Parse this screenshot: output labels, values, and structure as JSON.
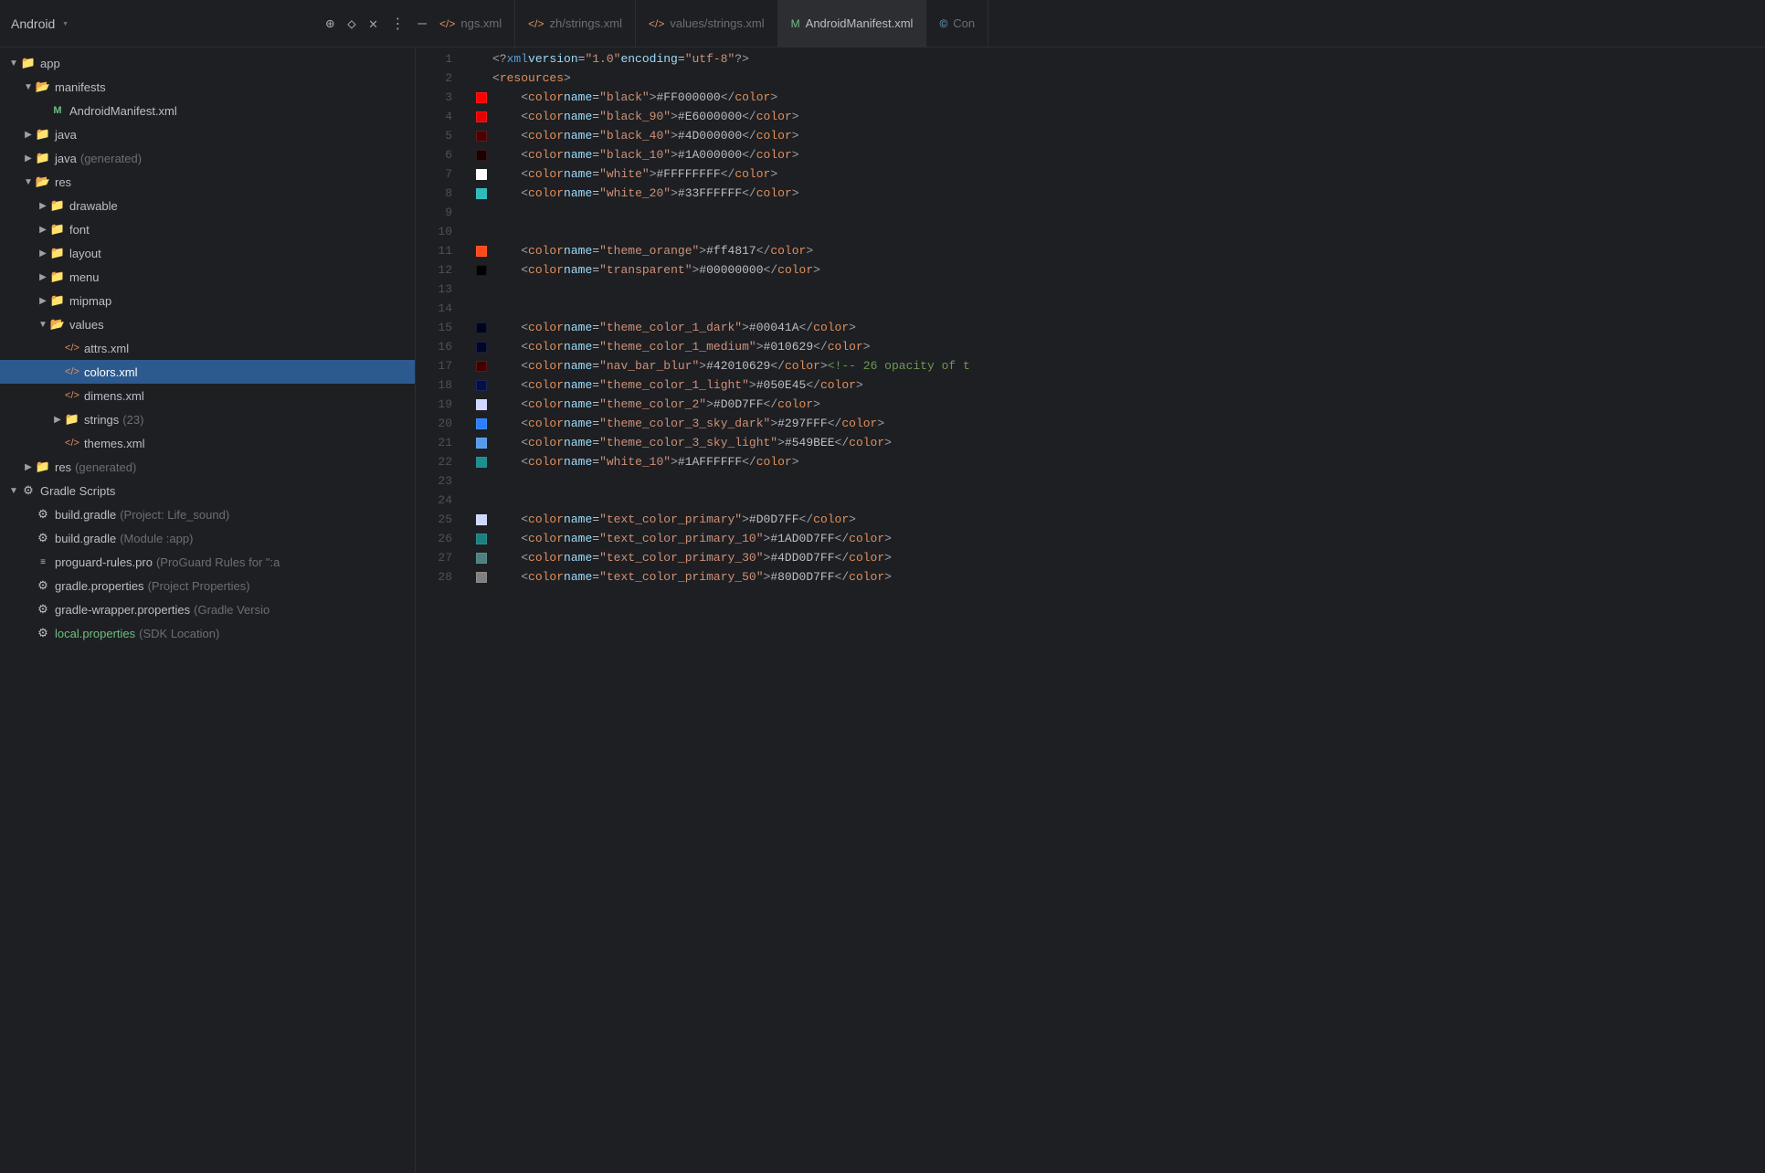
{
  "titleBar": {
    "appName": "Android",
    "chevron": "▾",
    "icons": [
      "+",
      "◇",
      "×",
      "⋮",
      "—"
    ]
  },
  "tabs": [
    {
      "id": "strings-xml",
      "icon": "</>",
      "label": "ngs.xml",
      "type": "xml"
    },
    {
      "id": "zh-strings",
      "icon": "</>",
      "label": "zh/strings.xml",
      "type": "xml"
    },
    {
      "id": "values-strings",
      "icon": "</>",
      "label": "values/strings.xml",
      "type": "xml"
    },
    {
      "id": "android-manifest",
      "icon": "M",
      "label": "AndroidManifest.xml",
      "type": "manifest"
    },
    {
      "id": "conf",
      "icon": "©",
      "label": "Con",
      "type": "conf"
    }
  ],
  "sidebar": {
    "items": [
      {
        "id": "app",
        "indent": 0,
        "arrow": "down",
        "icon": "folder",
        "label": "app",
        "labelMuted": ""
      },
      {
        "id": "manifests",
        "indent": 1,
        "arrow": "down",
        "icon": "folder-open",
        "label": "manifests",
        "labelMuted": ""
      },
      {
        "id": "android-manifest-file",
        "indent": 2,
        "arrow": "none",
        "icon": "manifest",
        "label": "AndroidManifest.xml",
        "labelMuted": ""
      },
      {
        "id": "java",
        "indent": 1,
        "arrow": "right",
        "icon": "folder",
        "label": "java",
        "labelMuted": ""
      },
      {
        "id": "java-generated",
        "indent": 1,
        "arrow": "right",
        "icon": "folder",
        "label": "java",
        "labelMuted": "(generated)"
      },
      {
        "id": "res",
        "indent": 1,
        "arrow": "down",
        "icon": "folder-open",
        "label": "res",
        "labelMuted": ""
      },
      {
        "id": "drawable",
        "indent": 2,
        "arrow": "right",
        "icon": "folder",
        "label": "drawable",
        "labelMuted": ""
      },
      {
        "id": "font",
        "indent": 2,
        "arrow": "right",
        "icon": "folder",
        "label": "font",
        "labelMuted": ""
      },
      {
        "id": "layout",
        "indent": 2,
        "arrow": "right",
        "icon": "folder",
        "label": "layout",
        "labelMuted": ""
      },
      {
        "id": "menu",
        "indent": 2,
        "arrow": "right",
        "icon": "folder",
        "label": "menu",
        "labelMuted": ""
      },
      {
        "id": "mipmap",
        "indent": 2,
        "arrow": "right",
        "icon": "folder",
        "label": "mipmap",
        "labelMuted": ""
      },
      {
        "id": "values",
        "indent": 2,
        "arrow": "down",
        "icon": "folder-open",
        "label": "values",
        "labelMuted": ""
      },
      {
        "id": "attrs-xml",
        "indent": 3,
        "arrow": "none",
        "icon": "xml",
        "label": "attrs.xml",
        "labelMuted": ""
      },
      {
        "id": "colors-xml",
        "indent": 3,
        "arrow": "none",
        "icon": "xml",
        "label": "colors.xml",
        "labelMuted": "",
        "selected": true
      },
      {
        "id": "dimens-xml",
        "indent": 3,
        "arrow": "none",
        "icon": "xml",
        "label": "dimens.xml",
        "labelMuted": ""
      },
      {
        "id": "strings",
        "indent": 3,
        "arrow": "right",
        "icon": "folder",
        "label": "strings",
        "labelMuted": "",
        "badge": "(23)"
      },
      {
        "id": "themes-xml",
        "indent": 3,
        "arrow": "none",
        "icon": "xml",
        "label": "themes.xml",
        "labelMuted": ""
      },
      {
        "id": "res-generated",
        "indent": 1,
        "arrow": "right",
        "icon": "folder",
        "label": "res",
        "labelMuted": "(generated)"
      },
      {
        "id": "gradle-scripts",
        "indent": 0,
        "arrow": "down",
        "icon": "gradle",
        "label": "Gradle Scripts",
        "labelMuted": ""
      },
      {
        "id": "build-gradle-project",
        "indent": 1,
        "arrow": "none",
        "icon": "gradle-file",
        "label": "build.gradle",
        "labelMuted": "(Project: Life_sound)"
      },
      {
        "id": "build-gradle-module",
        "indent": 1,
        "arrow": "none",
        "icon": "gradle-file",
        "label": "build.gradle",
        "labelMuted": "(Module :app)"
      },
      {
        "id": "proguard-rules",
        "indent": 1,
        "arrow": "none",
        "icon": "proguard",
        "label": "proguard-rules.pro",
        "labelMuted": "(ProGuard Rules for \":a"
      },
      {
        "id": "gradle-properties",
        "indent": 1,
        "arrow": "none",
        "icon": "properties",
        "label": "gradle.properties",
        "labelMuted": "(Project Properties)"
      },
      {
        "id": "gradle-wrapper",
        "indent": 1,
        "arrow": "none",
        "icon": "properties",
        "label": "gradle-wrapper.properties",
        "labelMuted": "(Gradle Versio"
      },
      {
        "id": "local-properties",
        "indent": 1,
        "arrow": "none",
        "icon": "properties",
        "label": "local.properties",
        "labelMuted": "(SDK Location)",
        "green": true
      }
    ]
  },
  "editor": {
    "lines": [
      {
        "num": 1,
        "swatch": null,
        "code": "<?xml version=\"1.0\" encoding=\"utf-8\"?>"
      },
      {
        "num": 2,
        "swatch": null,
        "code": "<resources>"
      },
      {
        "num": 3,
        "swatch": "#FF0000",
        "code": "    <color name=\"black\">#FF000000</color>"
      },
      {
        "num": 4,
        "swatch": "#E60000",
        "code": "    <color name=\"black_90\">#E6000000</color>"
      },
      {
        "num": 5,
        "swatch": "#4D0000",
        "code": "    <color name=\"black_40\">#4D000000</color>"
      },
      {
        "num": 6,
        "swatch": "#1A0000",
        "code": "    <color name=\"black_10\">#1A000000</color>"
      },
      {
        "num": 7,
        "swatch": "#FFFFFF",
        "code": "    <color name=\"white\">#FFFFFFFF</color>"
      },
      {
        "num": 8,
        "swatch": "#33FFFF",
        "code": "    <color name=\"white_20\">#33FFFFFF</color>"
      },
      {
        "num": 9,
        "swatch": null,
        "code": ""
      },
      {
        "num": 10,
        "swatch": null,
        "code": ""
      },
      {
        "num": 11,
        "swatch": "#ff4817",
        "code": "    <color name=\"theme_orange\">#ff4817</color>"
      },
      {
        "num": 12,
        "swatch": "#000000",
        "code": "    <color name=\"transparent\">#00000000</color>"
      },
      {
        "num": 13,
        "swatch": null,
        "code": ""
      },
      {
        "num": 14,
        "swatch": null,
        "code": ""
      },
      {
        "num": 15,
        "swatch": "#00041A",
        "code": "    <color name=\"theme_color_1_dark\">#00041A</color>"
      },
      {
        "num": 16,
        "swatch": "#010629",
        "code": "    <color name=\"theme_color_1_medium\">#010629</color>"
      },
      {
        "num": 17,
        "swatch": "#420000",
        "code": "    <color name=\"nav_bar_blur\">#42010629</color><!--   26 opacity of t"
      },
      {
        "num": 18,
        "swatch": "#050E45",
        "code": "    <color name=\"theme_color_1_light\">#050E45</color>"
      },
      {
        "num": 19,
        "swatch": "#D0D7FF",
        "code": "    <color name=\"theme_color_2\">#D0D7FF</color>"
      },
      {
        "num": 20,
        "swatch": "#297FFF",
        "code": "    <color name=\"theme_color_3_sky_dark\">#297FFF</color>"
      },
      {
        "num": 21,
        "swatch": "#549BEE",
        "code": "    <color name=\"theme_color_3_sky_light\">#549BEE</color>"
      },
      {
        "num": 22,
        "swatch": "#1AFFFF",
        "code": "    <color name=\"white_10\">#1AFFFFFF</color>"
      },
      {
        "num": 23,
        "swatch": null,
        "code": ""
      },
      {
        "num": 24,
        "swatch": null,
        "code": ""
      },
      {
        "num": 25,
        "swatch": "#D0D7FF",
        "code": "    <color name=\"text_color_primary\">#D0D7FF</color>"
      },
      {
        "num": 26,
        "swatch": "#1AD0D7",
        "code": "    <color name=\"text_color_primary_10\">#1AD0D7FF</color>"
      },
      {
        "num": 27,
        "swatch": "#4DD0D7",
        "code": "    <color name=\"text_color_primary_30\">#4DD0D7FF</color>"
      },
      {
        "num": 28,
        "swatch": "#80D0D7",
        "code": "    <color name=\"text_color_primary_50\">#80D0D7FF</color>"
      }
    ]
  }
}
